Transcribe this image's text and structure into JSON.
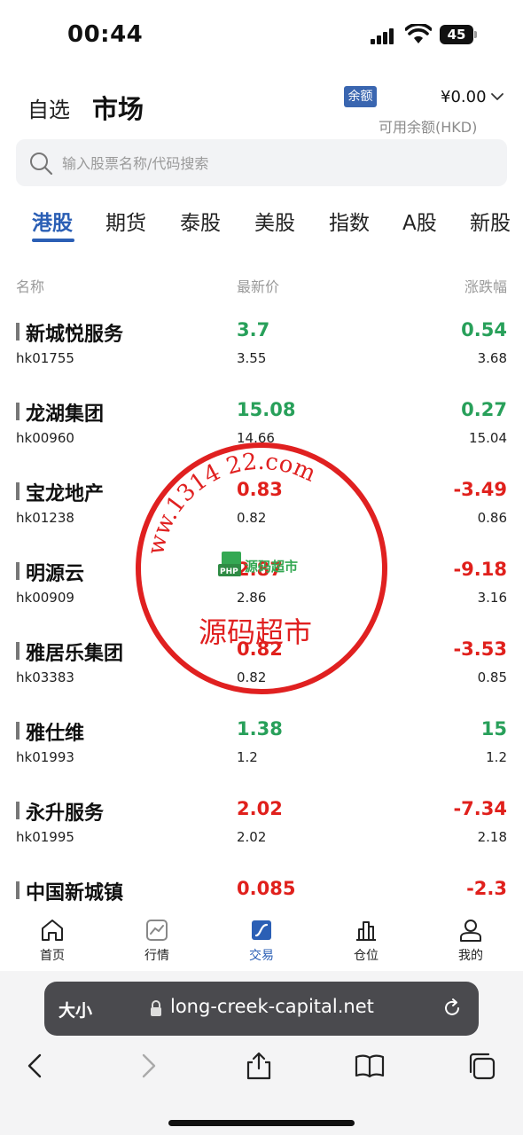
{
  "status_bar": {
    "time": "00:44",
    "battery": "45"
  },
  "header": {
    "tab_watchlist": "自选",
    "tab_market": "市场",
    "balance_badge": "余额",
    "balance_value": "¥0.00",
    "balance_label": "可用余额(HKD)"
  },
  "search": {
    "placeholder": "输入股票名称/代码搜索"
  },
  "market_tabs": [
    "港股",
    "期货",
    "泰股",
    "美股",
    "指数",
    "A股",
    "新股"
  ],
  "table": {
    "headers": {
      "name": "名称",
      "price": "最新价",
      "change": "涨跌幅"
    },
    "rows": [
      {
        "name": "新城悦服务",
        "code": "hk01755",
        "price": "3.7",
        "prev": "3.55",
        "change": "0.54",
        "ref": "3.68",
        "trend": "up"
      },
      {
        "name": "龙湖集团",
        "code": "hk00960",
        "price": "15.08",
        "prev": "14.66",
        "change": "0.27",
        "ref": "15.04",
        "trend": "up"
      },
      {
        "name": "宝龙地产",
        "code": "hk01238",
        "price": "0.83",
        "prev": "0.82",
        "change": "-3.49",
        "ref": "0.86",
        "trend": "down"
      },
      {
        "name": "明源云",
        "code": "hk00909",
        "price": "2.87",
        "prev": "2.86",
        "change": "-9.18",
        "ref": "3.16",
        "trend": "down"
      },
      {
        "name": "雅居乐集团",
        "code": "hk03383",
        "price": "0.82",
        "prev": "0.82",
        "change": "-3.53",
        "ref": "0.85",
        "trend": "down"
      },
      {
        "name": "雅仕维",
        "code": "hk01993",
        "price": "1.38",
        "prev": "1.2",
        "change": "15",
        "ref": "1.2",
        "trend": "up"
      },
      {
        "name": "永升服务",
        "code": "hk01995",
        "price": "2.02",
        "prev": "2.02",
        "change": "-7.34",
        "ref": "2.18",
        "trend": "down"
      },
      {
        "name": "中国新城镇",
        "code": "",
        "price": "0.085",
        "prev": "",
        "change": "-2.3",
        "ref": "",
        "trend": "down"
      }
    ]
  },
  "bottom_nav": [
    {
      "label": "首页",
      "icon": "home-icon"
    },
    {
      "label": "行情",
      "icon": "chart-icon"
    },
    {
      "label": "交易",
      "icon": "trade-icon"
    },
    {
      "label": "仓位",
      "icon": "position-icon"
    },
    {
      "label": "我的",
      "icon": "profile-icon"
    }
  ],
  "browser": {
    "aa_label": "大小",
    "url": "long-creek-capital.net"
  },
  "watermark": {
    "ring_text": "ww.1314 22.com",
    "center_text": "源码超市",
    "logo_text": "PHP 源码超市"
  },
  "colors": {
    "accent": "#2b5fb5",
    "up": "#28a05a",
    "down": "#e0201c",
    "stamp": "#e02020"
  }
}
